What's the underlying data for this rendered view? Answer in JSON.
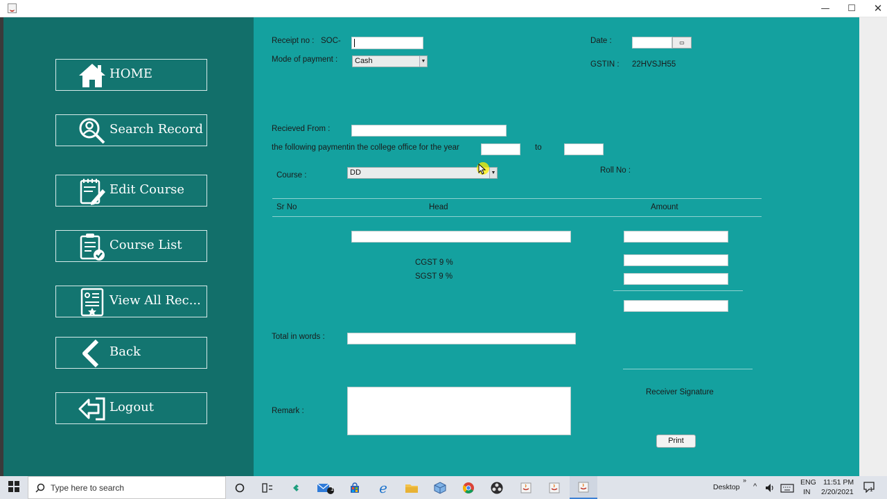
{
  "window": {
    "minimize": "—",
    "maximize": "☐",
    "close": "✕"
  },
  "sidebar": {
    "items": [
      {
        "label": "HOME",
        "icon": "home-icon"
      },
      {
        "label": "Search Record",
        "icon": "search-user-icon"
      },
      {
        "label": "Edit Course",
        "icon": "edit-document-icon"
      },
      {
        "label": "Course List",
        "icon": "clipboard-check-icon"
      },
      {
        "label": "View All Rec...",
        "icon": "records-list-icon"
      },
      {
        "label": "Back",
        "icon": "chevron-left-icon"
      },
      {
        "label": "Logout",
        "icon": "logout-arrow-icon"
      }
    ]
  },
  "form": {
    "receipt_label": "Receipt no :",
    "receipt_prefix": "SOC-",
    "receipt_value": "",
    "date_label": "Date :",
    "mode_label": "Mode of payment :",
    "mode_value": "Cash",
    "gstin_label": "GSTIN :",
    "gstin_value": "22HVSJH55",
    "received_from_label": "Recieved From :",
    "following_payment_label": "the following paymentin the college office for the year",
    "to_label": "to",
    "course_label": "Course :",
    "course_value": "DD",
    "roll_no_label": "Roll No :",
    "table_headers": [
      "Sr No",
      "Head",
      "Amount"
    ],
    "cgst_label": "CGST 9 %",
    "sgst_label": "SGST 9 %",
    "total_words_label": "Total in words :",
    "remark_label": "Remark :",
    "receiver_signature_label": "Receiver Signature",
    "print_button": "Print"
  },
  "taskbar": {
    "search_placeholder": "Type here to search",
    "desktop_label": "Desktop",
    "lang_top": "ENG",
    "lang_bottom": "IN",
    "time": "11:51 PM",
    "date": "2/20/2021",
    "notification_count": "1",
    "mail_badge": "1"
  },
  "colors": {
    "sidebar_bg": "#126f6a",
    "main_bg": "#14a19f"
  }
}
